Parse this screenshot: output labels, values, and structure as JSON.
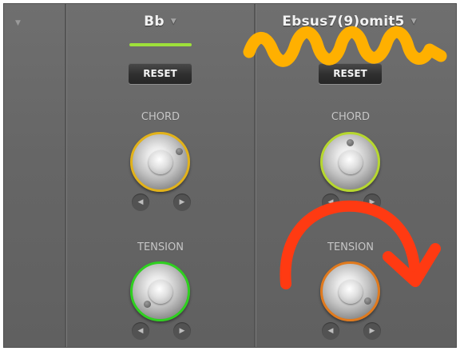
{
  "colors": {
    "panel_bg": "#666666",
    "green_indicator": "#9ee03a",
    "yellow_scribble": "#ffb000",
    "red_arrow": "#ff3a12",
    "knob_chord_left": "#e2b21a",
    "knob_chord_right": "#b6d72f",
    "knob_tension_left": "#2fd020",
    "knob_tension_right": "#e07a1e"
  },
  "columns": [
    {
      "chord_name": "Bb",
      "reset_label": "RESET",
      "chord_label": "CHORD",
      "tension_label": "TENSION"
    },
    {
      "chord_name": "Ebsus7(9)omit5",
      "reset_label": "RESET",
      "chord_label": "CHORD",
      "tension_label": "TENSION"
    }
  ],
  "icons": {
    "dropdown": "chevron-down-icon",
    "left": "arrow-left-icon",
    "right": "arrow-right-icon"
  }
}
